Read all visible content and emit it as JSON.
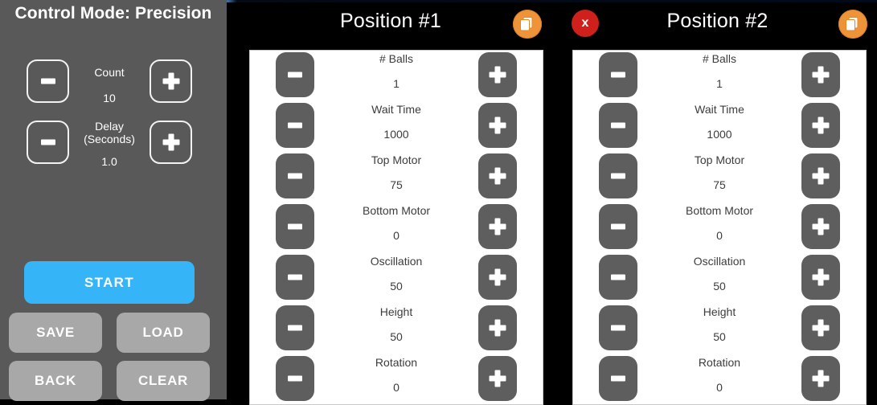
{
  "sidebar": {
    "title": "Control Mode: Precision",
    "steppers": [
      {
        "label": "Count",
        "value": "10",
        "minus": "−",
        "plus": "+"
      },
      {
        "label": "Delay\n(Seconds)",
        "label_line1": "Delay",
        "label_line2": "(Seconds)",
        "value": "1.0",
        "minus": "−",
        "plus": "+"
      }
    ],
    "start_label": "START",
    "save_label": "SAVE",
    "load_label": "LOAD",
    "back_label": "BACK",
    "clear_label": "CLEAR",
    "accent_start": "#35b5f7",
    "gray_button": "#a8a8a8",
    "background": "#595959"
  },
  "panels": [
    {
      "title": "Position #1",
      "copy_icon": "copy-pages-icon",
      "close_icon": null,
      "rows": [
        {
          "label": "# Balls",
          "value": "1"
        },
        {
          "label": "Wait Time",
          "value": "1000"
        },
        {
          "label": "Top Motor",
          "value": "75"
        },
        {
          "label": "Bottom Motor",
          "value": "0"
        },
        {
          "label": "Oscillation",
          "value": "50"
        },
        {
          "label": "Height",
          "value": "50"
        },
        {
          "label": "Rotation",
          "value": "0"
        }
      ]
    },
    {
      "title": "Position #2",
      "copy_icon": "copy-pages-icon",
      "close_icon": "close-x-icon",
      "close_label": "x",
      "rows": [
        {
          "label": "# Balls",
          "value": "1"
        },
        {
          "label": "Wait Time",
          "value": "1000"
        },
        {
          "label": "Top Motor",
          "value": "75"
        },
        {
          "label": "Bottom Motor",
          "value": "0"
        },
        {
          "label": "Oscillation",
          "value": "50"
        },
        {
          "label": "Height",
          "value": "50"
        },
        {
          "label": "Rotation",
          "value": "0"
        }
      ]
    }
  ],
  "colors": {
    "copy_icon_bg": "#ef9338",
    "close_icon_bg": "#d0201c",
    "stepper_button": "#5e5e5e",
    "panel_bg": "#ffffff",
    "app_bg": "#000000"
  }
}
